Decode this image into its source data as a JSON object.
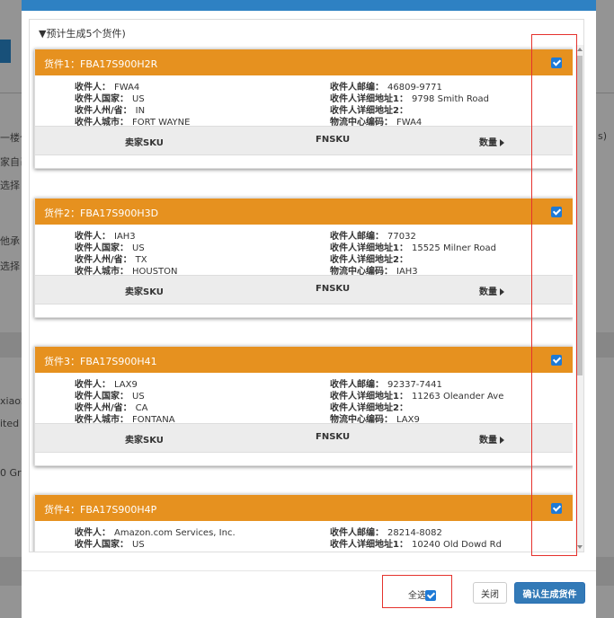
{
  "background": {
    "fragments": [
      "一楼仓",
      "家自己",
      "选择",
      "他承",
      "选择",
      "xiaoS",
      "ited S",
      "0 Gr",
      "s)"
    ]
  },
  "panel": {
    "title": "▼预计生成5个货件)"
  },
  "shipments": [
    {
      "title": "货件1：FBA17S900H2R",
      "checked": true,
      "fields": [
        {
          "label": "收件人：",
          "value": "FWA4"
        },
        {
          "label": "收件人邮编：",
          "value": "46809-9771"
        },
        {
          "label": "收件人国家：",
          "value": "US"
        },
        {
          "label": "收件人详细地址1：",
          "value": "9798 Smith Road"
        },
        {
          "label": "收件人州/省：",
          "value": "IN"
        },
        {
          "label": "收件人详细地址2：",
          "value": ""
        },
        {
          "label": "收件人城市：",
          "value": "FORT WAYNE"
        },
        {
          "label": "物流中心编码：",
          "value": "FWA4"
        }
      ]
    },
    {
      "title": "货件2：FBA17S900H3D",
      "checked": true,
      "fields": [
        {
          "label": "收件人：",
          "value": "IAH3"
        },
        {
          "label": "收件人邮编：",
          "value": "77032"
        },
        {
          "label": "收件人国家：",
          "value": "US"
        },
        {
          "label": "收件人详细地址1：",
          "value": "15525 Milner Road"
        },
        {
          "label": "收件人州/省：",
          "value": "TX"
        },
        {
          "label": "收件人详细地址2：",
          "value": ""
        },
        {
          "label": "收件人城市：",
          "value": "HOUSTON"
        },
        {
          "label": "物流中心编码：",
          "value": "IAH3"
        }
      ]
    },
    {
      "title": "货件3：FBA17S900H41",
      "checked": true,
      "fields": [
        {
          "label": "收件人：",
          "value": "LAX9"
        },
        {
          "label": "收件人邮编：",
          "value": "92337-7441"
        },
        {
          "label": "收件人国家：",
          "value": "US"
        },
        {
          "label": "收件人详细地址1：",
          "value": "11263 Oleander Ave"
        },
        {
          "label": "收件人州/省：",
          "value": "CA"
        },
        {
          "label": "收件人详细地址2：",
          "value": ""
        },
        {
          "label": "收件人城市：",
          "value": "FONTANA"
        },
        {
          "label": "物流中心编码：",
          "value": "LAX9"
        }
      ]
    },
    {
      "title": "货件4：FBA17S900H4P",
      "checked": true,
      "fields": [
        {
          "label": "收件人：",
          "value": "Amazon.com Services, Inc."
        },
        {
          "label": "收件人邮编：",
          "value": "28214-8082"
        },
        {
          "label": "收件人国家：",
          "value": "US"
        },
        {
          "label": "收件人详细地址1：",
          "value": "10240 Old Dowd Rd"
        }
      ]
    }
  ],
  "table_headers": {
    "seller_sku": "卖家SKU",
    "fnsku": "FNSKU",
    "quantity": "数量"
  },
  "footer": {
    "select_all_label": "全选",
    "close_label": "关闭",
    "confirm_label": "确认生成货件"
  },
  "colors": {
    "card_header": "#e6911f",
    "primary_button": "#337ab7",
    "annotation": "#e5322d"
  },
  "icons": {
    "checkbox": "checkbox-checked-icon",
    "sort": "triangle-right-icon"
  }
}
